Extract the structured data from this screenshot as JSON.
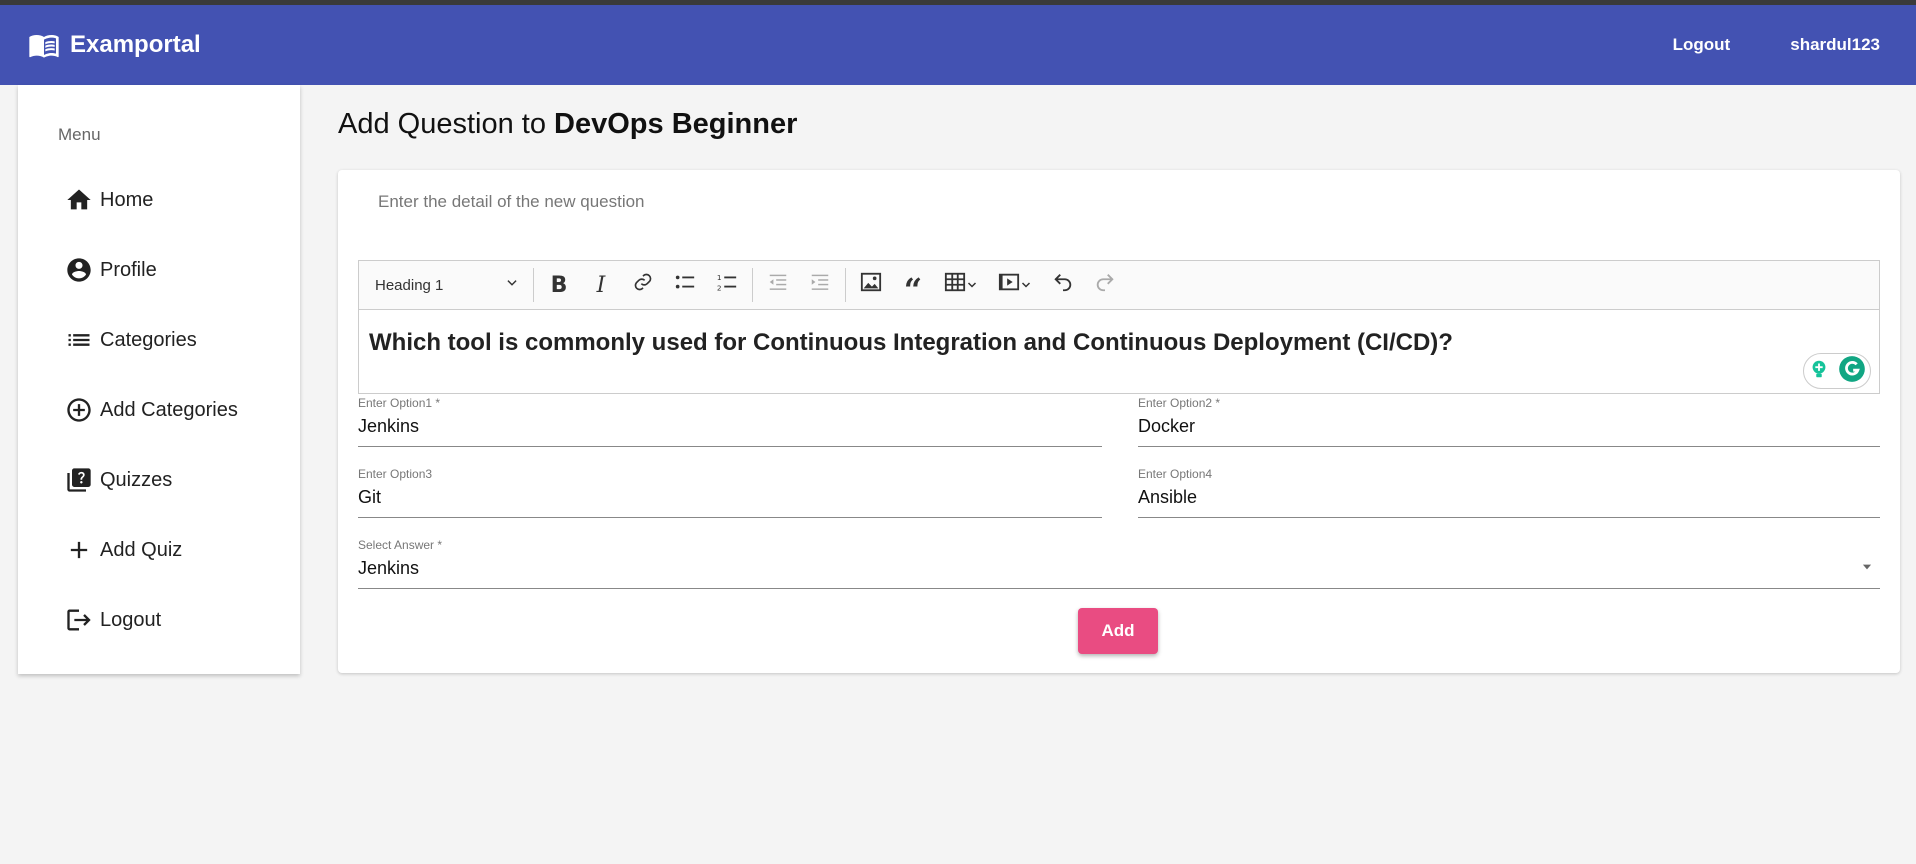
{
  "navbar": {
    "brand_title": "Examportal",
    "logout_label": "Logout",
    "username": "shardul123",
    "background_color": "#4352b2"
  },
  "sidebar": {
    "menu_title": "Menu",
    "items": [
      {
        "label": "Home",
        "icon": "home-icon"
      },
      {
        "label": "Profile",
        "icon": "account-circle-icon"
      },
      {
        "label": "Categories",
        "icon": "list-icon"
      },
      {
        "label": "Add Categories",
        "icon": "add-circle-outline-icon"
      },
      {
        "label": "Quizzes",
        "icon": "quiz-icon"
      },
      {
        "label": "Add Quiz",
        "icon": "plus-icon"
      },
      {
        "label": "Logout",
        "icon": "logout-icon"
      }
    ]
  },
  "page": {
    "title_prefix": "Add Question to",
    "quiz_name": "DevOps Beginner"
  },
  "form": {
    "subtitle": "Enter the detail of the new question",
    "editor": {
      "heading_select": "Heading 1",
      "content": "Which tool is commonly used for Continuous Integration and Continuous Deployment (CI/CD)?"
    },
    "option1": {
      "label": "Enter Option1 *",
      "value": "Jenkins"
    },
    "option2": {
      "label": "Enter Option2 *",
      "value": "Docker"
    },
    "option3": {
      "label": "Enter Option3",
      "value": "Git"
    },
    "option4": {
      "label": "Enter Option4",
      "value": "Ansible"
    },
    "answer": {
      "label": "Select Answer *",
      "value": "Jenkins"
    },
    "add_button": "Add",
    "add_button_color": "#e94c82"
  }
}
